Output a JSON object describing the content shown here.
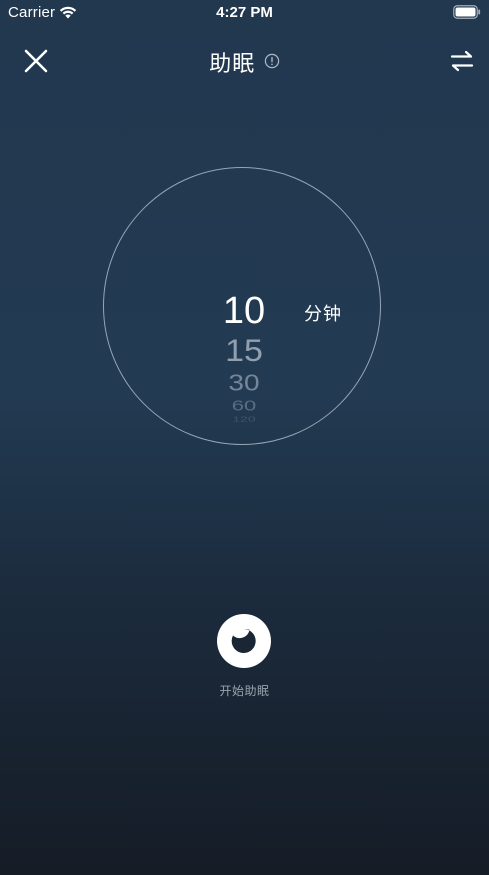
{
  "status_bar": {
    "carrier": "Carrier",
    "time": "4:27 PM",
    "wifi_icon": "wifi-icon",
    "battery_icon": "battery-full-icon"
  },
  "nav": {
    "close_icon": "close-icon",
    "title": "助眠",
    "info_icon": "info-icon",
    "swap_icon": "swap-arrows-icon"
  },
  "timer": {
    "options": [
      "10",
      "15",
      "30",
      "60",
      "120"
    ],
    "selected": "10",
    "unit": "分钟"
  },
  "start": {
    "icon": "moon-icon",
    "label": "开始助眠"
  },
  "colors": {
    "background_top": "#22384f",
    "background_bottom": "#151c26",
    "ring": "#c8d4e2",
    "text_primary": "#ffffff",
    "text_secondary": "#dce4ee"
  }
}
